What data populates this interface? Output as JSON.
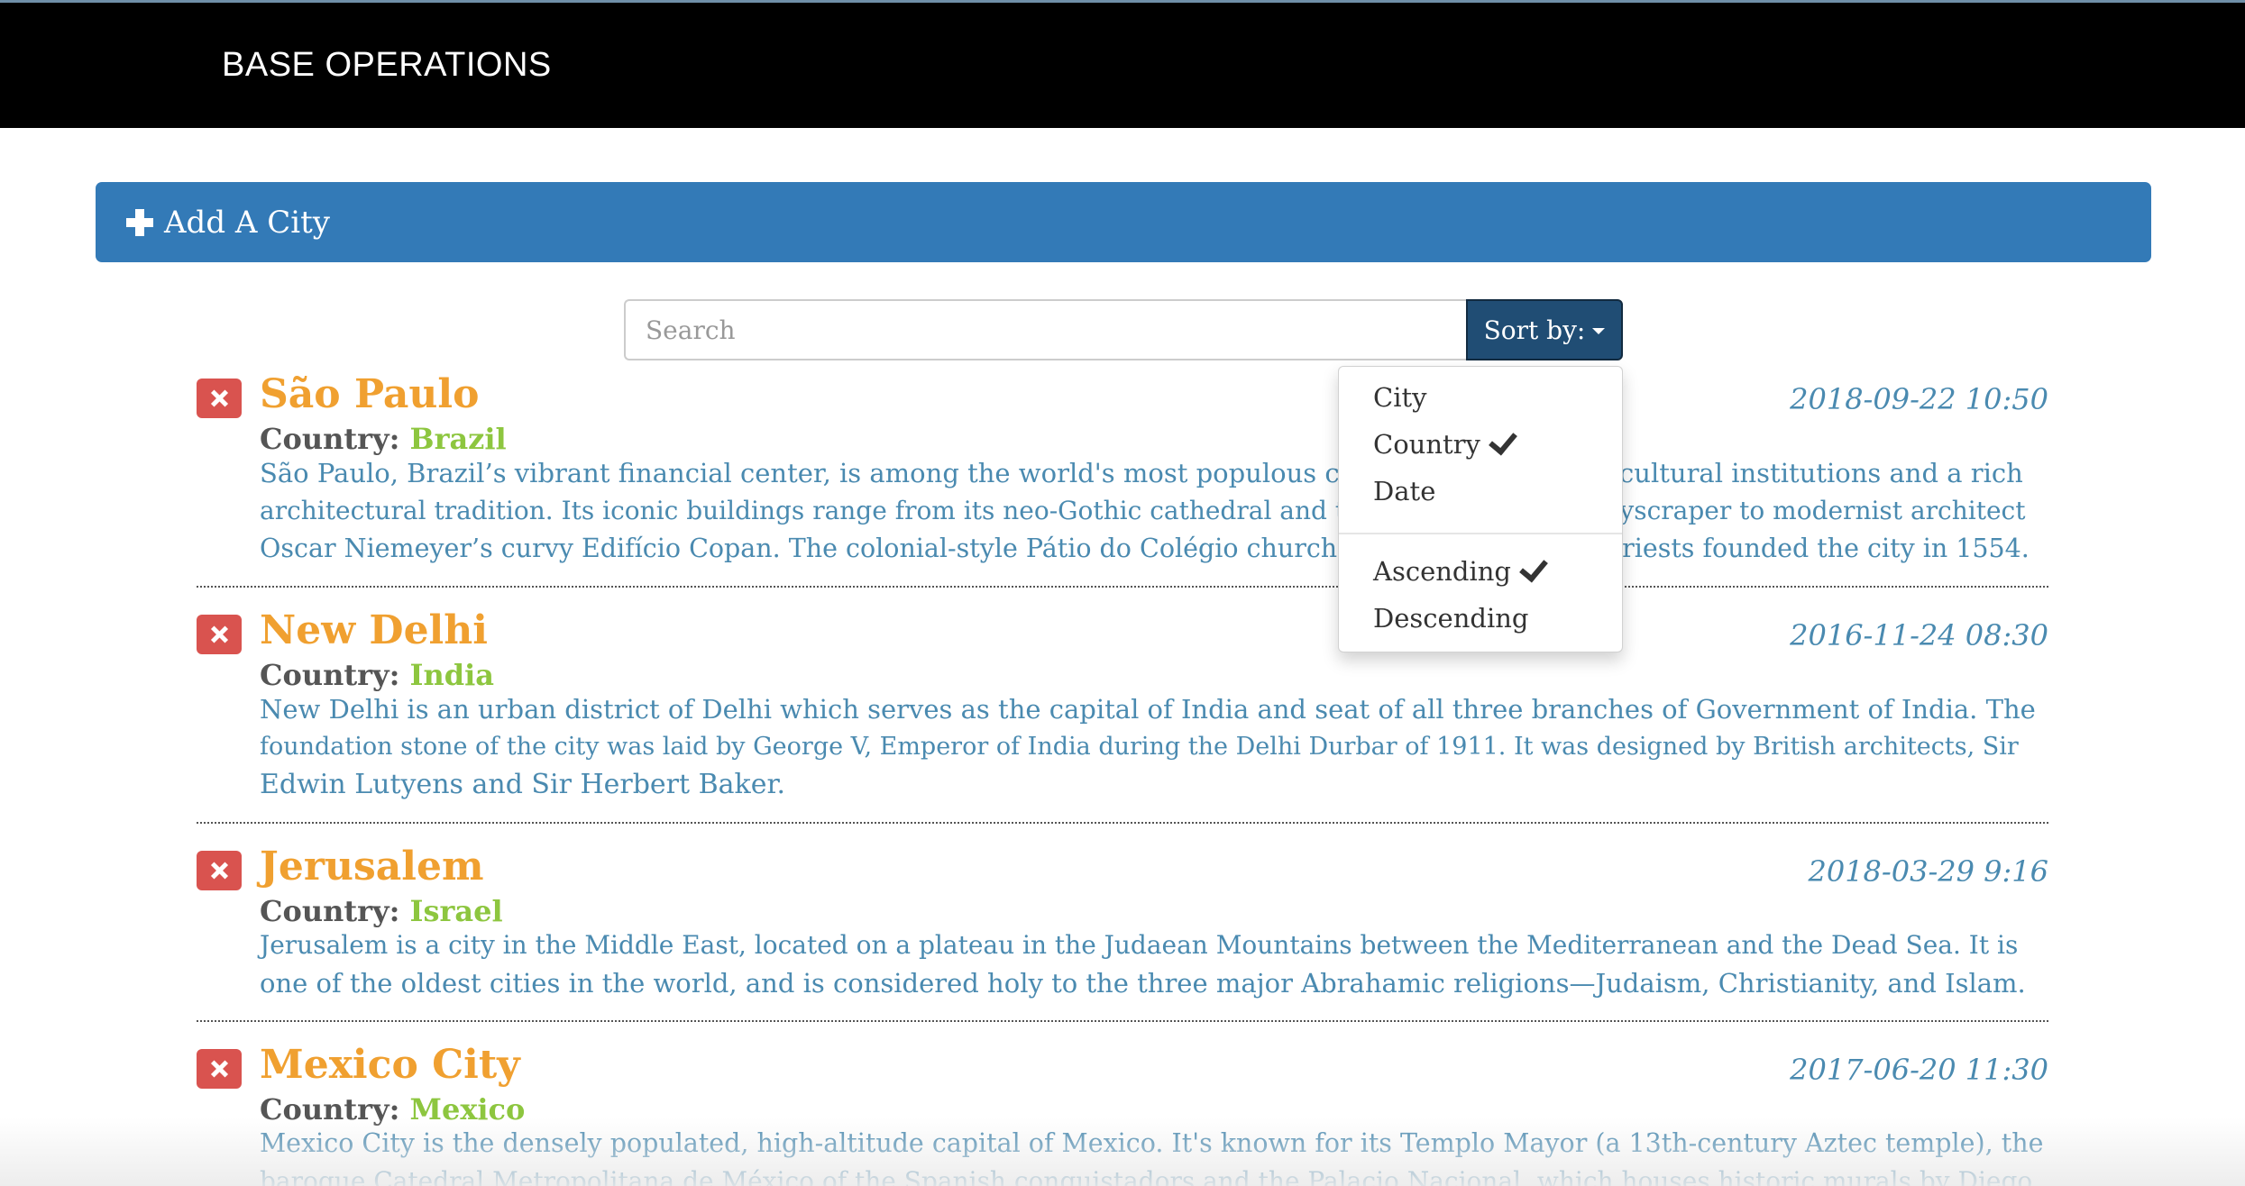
{
  "navbar": {
    "brand": "BASE OPERATIONS"
  },
  "add_city": {
    "icon": "plus-icon",
    "label": "Add A City"
  },
  "search": {
    "placeholder": "Search",
    "value": ""
  },
  "sort": {
    "button_label": "Sort by:",
    "field_options": [
      {
        "label": "City",
        "selected": false
      },
      {
        "label": "Country",
        "selected": true
      },
      {
        "label": "Date",
        "selected": false
      }
    ],
    "order_options": [
      {
        "label": "Ascending",
        "selected": true
      },
      {
        "label": "Descending",
        "selected": false
      }
    ]
  },
  "colors": {
    "navbar_bg": "#000000",
    "add_bar_bg": "#337ab7",
    "sort_button_bg": "#204d74",
    "city_name": "#f0a030",
    "country_value": "#8dc63f",
    "text_blue": "#4a8ab0",
    "delete_button": "#d9534f"
  },
  "country_label": "Country:",
  "cities": [
    {
      "name": "São Paulo",
      "country": "Brazil",
      "date": "2018-09-22 10:50",
      "description_lines": [
        "São Paulo, Brazil’s vibrant financial center, is among the world's most populous cities, with numerous cultural institutions and a rich",
        "architectural tradition. Its iconic buildings range from its neo-Gothic cathedral and the 1929 Martinelli skyscraper to modernist architect",
        "Oscar Niemeyer’s curvy Edifício Copan. The colonial-style Pátio do Colégio church marks where Jesuit priests founded the city in 1554."
      ]
    },
    {
      "name": "New Delhi",
      "country": "India",
      "date": "2016-11-24 08:30",
      "description_lines": [
        "New Delhi is an urban district of Delhi which serves as the capital of India and seat of all three branches of Government of India. The",
        "foundation stone of the city was laid by George V, Emperor of India during the Delhi Durbar of 1911. It was designed by British architects, Sir",
        "Edwin Lutyens and Sir Herbert Baker."
      ]
    },
    {
      "name": "Jerusalem",
      "country": "Israel",
      "date": "2018-03-29 9:16",
      "description_lines": [
        "Jerusalem is a city in the Middle East, located on a plateau in the Judaean Mountains between the Mediterranean and the Dead Sea. It is",
        "one of the oldest cities in the world, and is considered holy to the three major Abrahamic religions—Judaism, Christianity, and Islam."
      ]
    },
    {
      "name": "Mexico City",
      "country": "Mexico",
      "date": "2017-06-20 11:30",
      "description_lines": [
        "Mexico City is the densely populated, high-altitude capital of Mexico. It's known for its Templo Mayor (a 13th-century Aztec temple), the",
        "baroque Catedral Metropolitana de México of the Spanish conquistadors and the Palacio Nacional, which houses historic murals by Diego"
      ]
    }
  ]
}
